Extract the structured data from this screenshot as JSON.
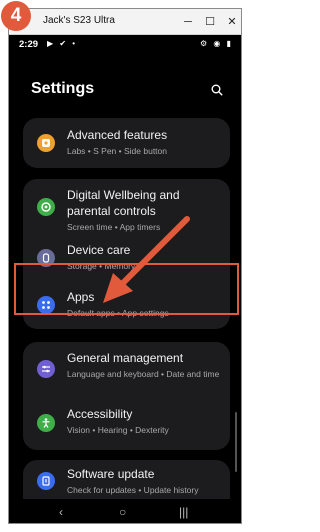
{
  "window": {
    "title": "Jack's S23 Ultra",
    "min_glyph": "─",
    "max_glyph": "☐",
    "close_glyph": "✕"
  },
  "step_badge": "4",
  "status_bar": {
    "time": "2:29",
    "left_icons": "▶ ✔ •",
    "right_icons": "⚙ ◉ ▮"
  },
  "header": {
    "title": "Settings"
  },
  "settings_items": [
    {
      "title": "Advanced features",
      "subtitle": "Labs • S Pen • Side button",
      "icon": "puzzle-icon",
      "color": "#f0a030"
    },
    {
      "title": "Digital Wellbeing and parental controls",
      "subtitle": "Screen time • App timers",
      "icon": "wellbeing-icon",
      "color": "#3fae49"
    },
    {
      "title": "Device care",
      "subtitle": "Storage • Memory",
      "icon": "device-care-icon",
      "color": "#6b6b9a"
    },
    {
      "title": "Apps",
      "subtitle": "Default apps • App settings",
      "icon": "apps-icon",
      "color": "#3a6cf0"
    },
    {
      "title": "General management",
      "subtitle": "Language and keyboard • Date and time",
      "icon": "sliders-icon",
      "color": "#6f5fd0"
    },
    {
      "title": "Accessibility",
      "subtitle": "Vision • Hearing • Dexterity",
      "icon": "accessibility-icon",
      "color": "#3fae49"
    },
    {
      "title": "Software update",
      "subtitle": "Check for updates • Update history",
      "icon": "software-update-icon",
      "color": "#3a6cf0"
    }
  ],
  "nav": {
    "back": "‹",
    "home": "○",
    "recents": "|||"
  },
  "accent_color": "#e25a3c"
}
